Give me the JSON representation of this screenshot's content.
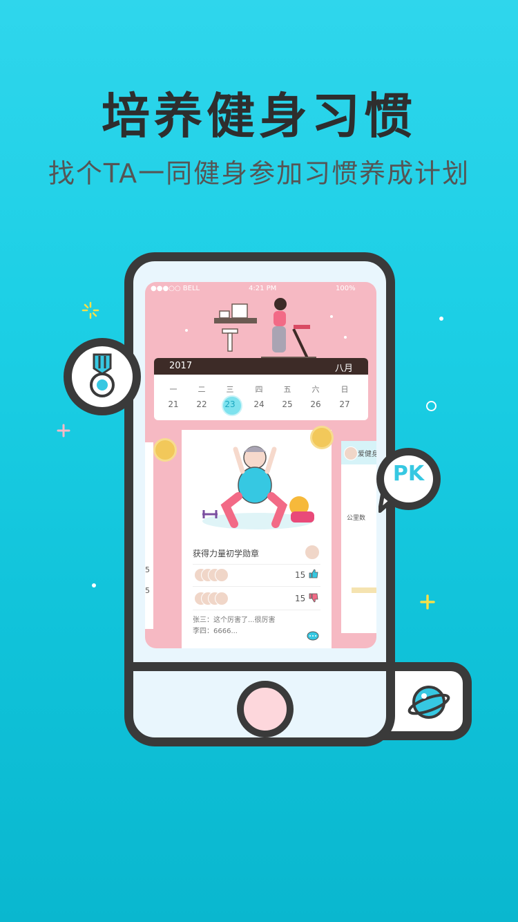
{
  "hero": {
    "headline": "培养健身习惯",
    "subline": "找个TA一同健身参加习惯养成计划"
  },
  "colors": {
    "background": "#1ccfe5",
    "accent": "#36c8e2",
    "screen_pink": "#f6b9c3",
    "outline": "#3a3a3a"
  },
  "status_bar": {
    "carrier": "●●●○○ BELL",
    "time": "4:21 PM",
    "battery": "100%"
  },
  "calendar": {
    "year": "2017",
    "month": "八月",
    "weekdays": [
      "一",
      "二",
      "三",
      "四",
      "五",
      "六",
      "日"
    ],
    "days": [
      "21",
      "22",
      "23",
      "24",
      "25",
      "26",
      "27"
    ],
    "selected_day": "23"
  },
  "feed_card": {
    "title": "获得力量初学勋章",
    "likes": "15",
    "dislikes": "15",
    "comments": [
      "张三：这个厉害了...很厉害",
      "李四：6666..."
    ]
  },
  "left_card": {
    "likes": "5",
    "dislikes": "5"
  },
  "right_card": {
    "title": "爱健身",
    "label": "公里数"
  },
  "pk_bubble": {
    "label": "PK"
  },
  "icons": [
    "medal-icon",
    "pk-bubble-icon",
    "planet-icon",
    "heart-icon",
    "like-icon",
    "dislike-icon",
    "comment-icon",
    "sparkle-icon",
    "plus-icon"
  ]
}
